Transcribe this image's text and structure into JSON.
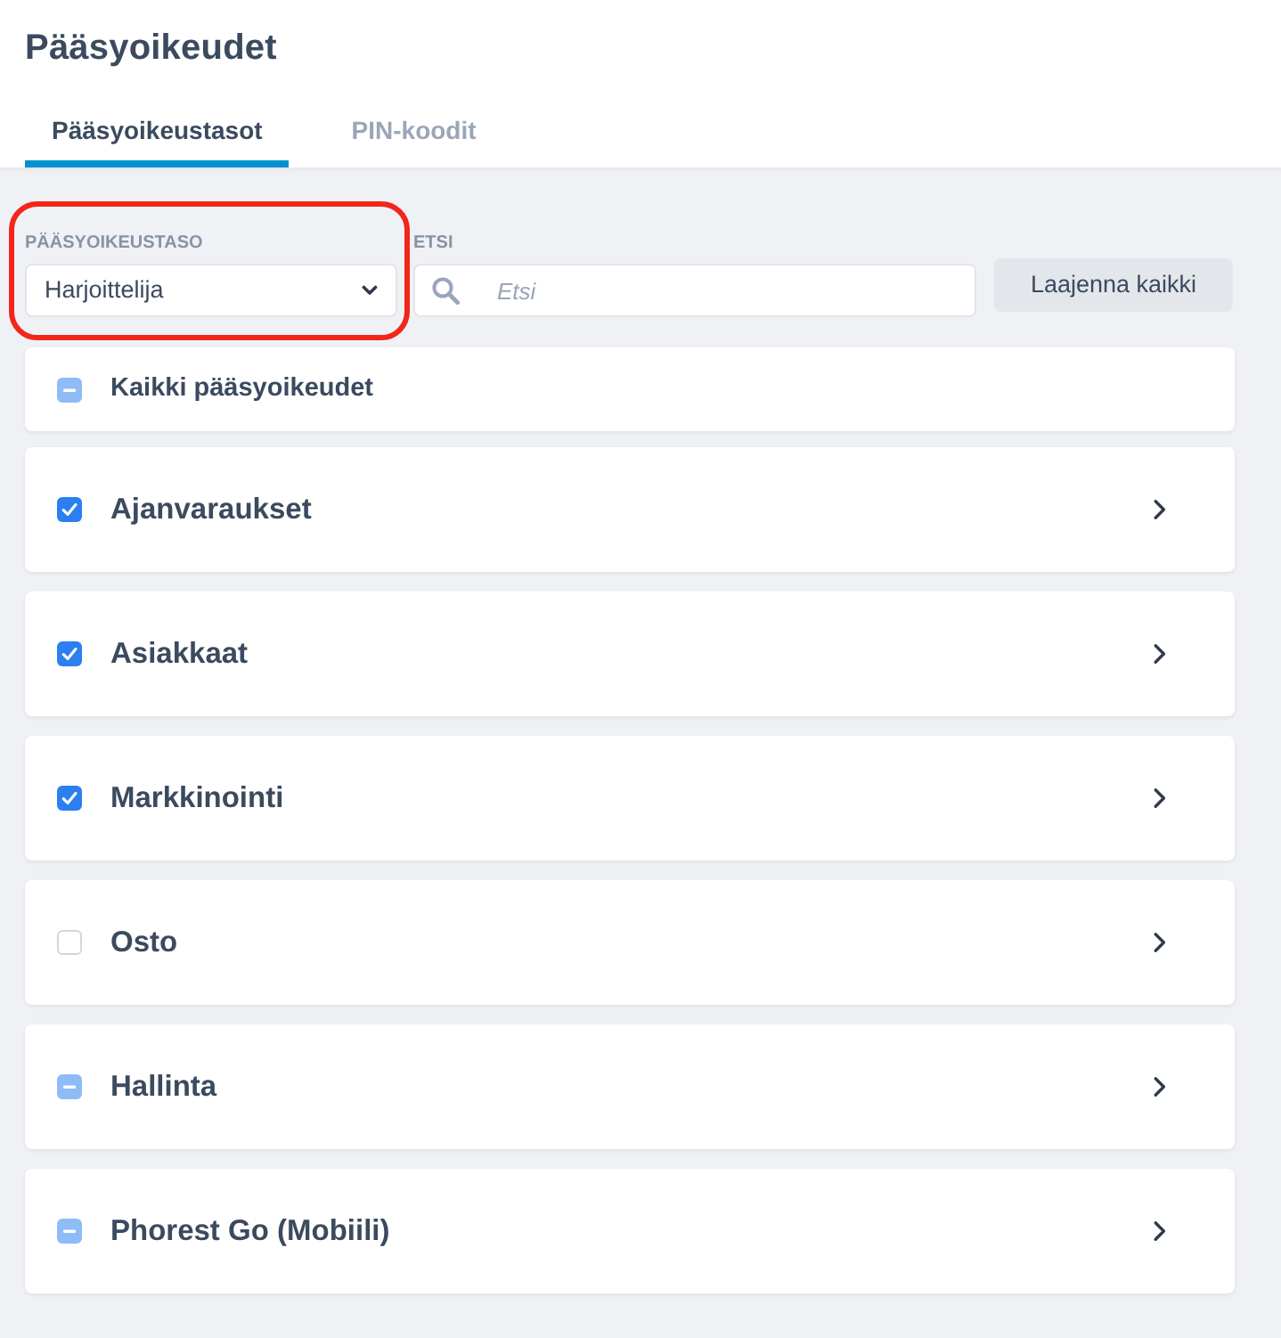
{
  "page": {
    "title": "Pääsyoikeudet"
  },
  "tabs": [
    {
      "label": "Pääsyoikeustasot",
      "selected": true
    },
    {
      "label": "PIN-koodit",
      "selected": false
    }
  ],
  "filters": {
    "level": {
      "label": "PÄÄSYOIKEUSTASO",
      "value": "Harjoittelija",
      "highlighted": true
    },
    "search": {
      "label": "ETSI",
      "placeholder": "Etsi"
    },
    "expand_button": "Laajenna kaikki"
  },
  "select_all": {
    "label": "Kaikki pääsyoikeudet",
    "checked": false,
    "indeterminate": true
  },
  "items": [
    {
      "label": "Ajanvaraukset",
      "checked": true,
      "indeterminate": false
    },
    {
      "label": "Asiakkaat",
      "checked": true,
      "indeterminate": false
    },
    {
      "label": "Markkinointi",
      "checked": true,
      "indeterminate": false
    },
    {
      "label": "Osto",
      "checked": false,
      "indeterminate": false
    },
    {
      "label": "Hallinta",
      "checked": false,
      "indeterminate": true
    },
    {
      "label": "Phorest Go (Mobiili)",
      "checked": false,
      "indeterminate": true
    }
  ]
}
